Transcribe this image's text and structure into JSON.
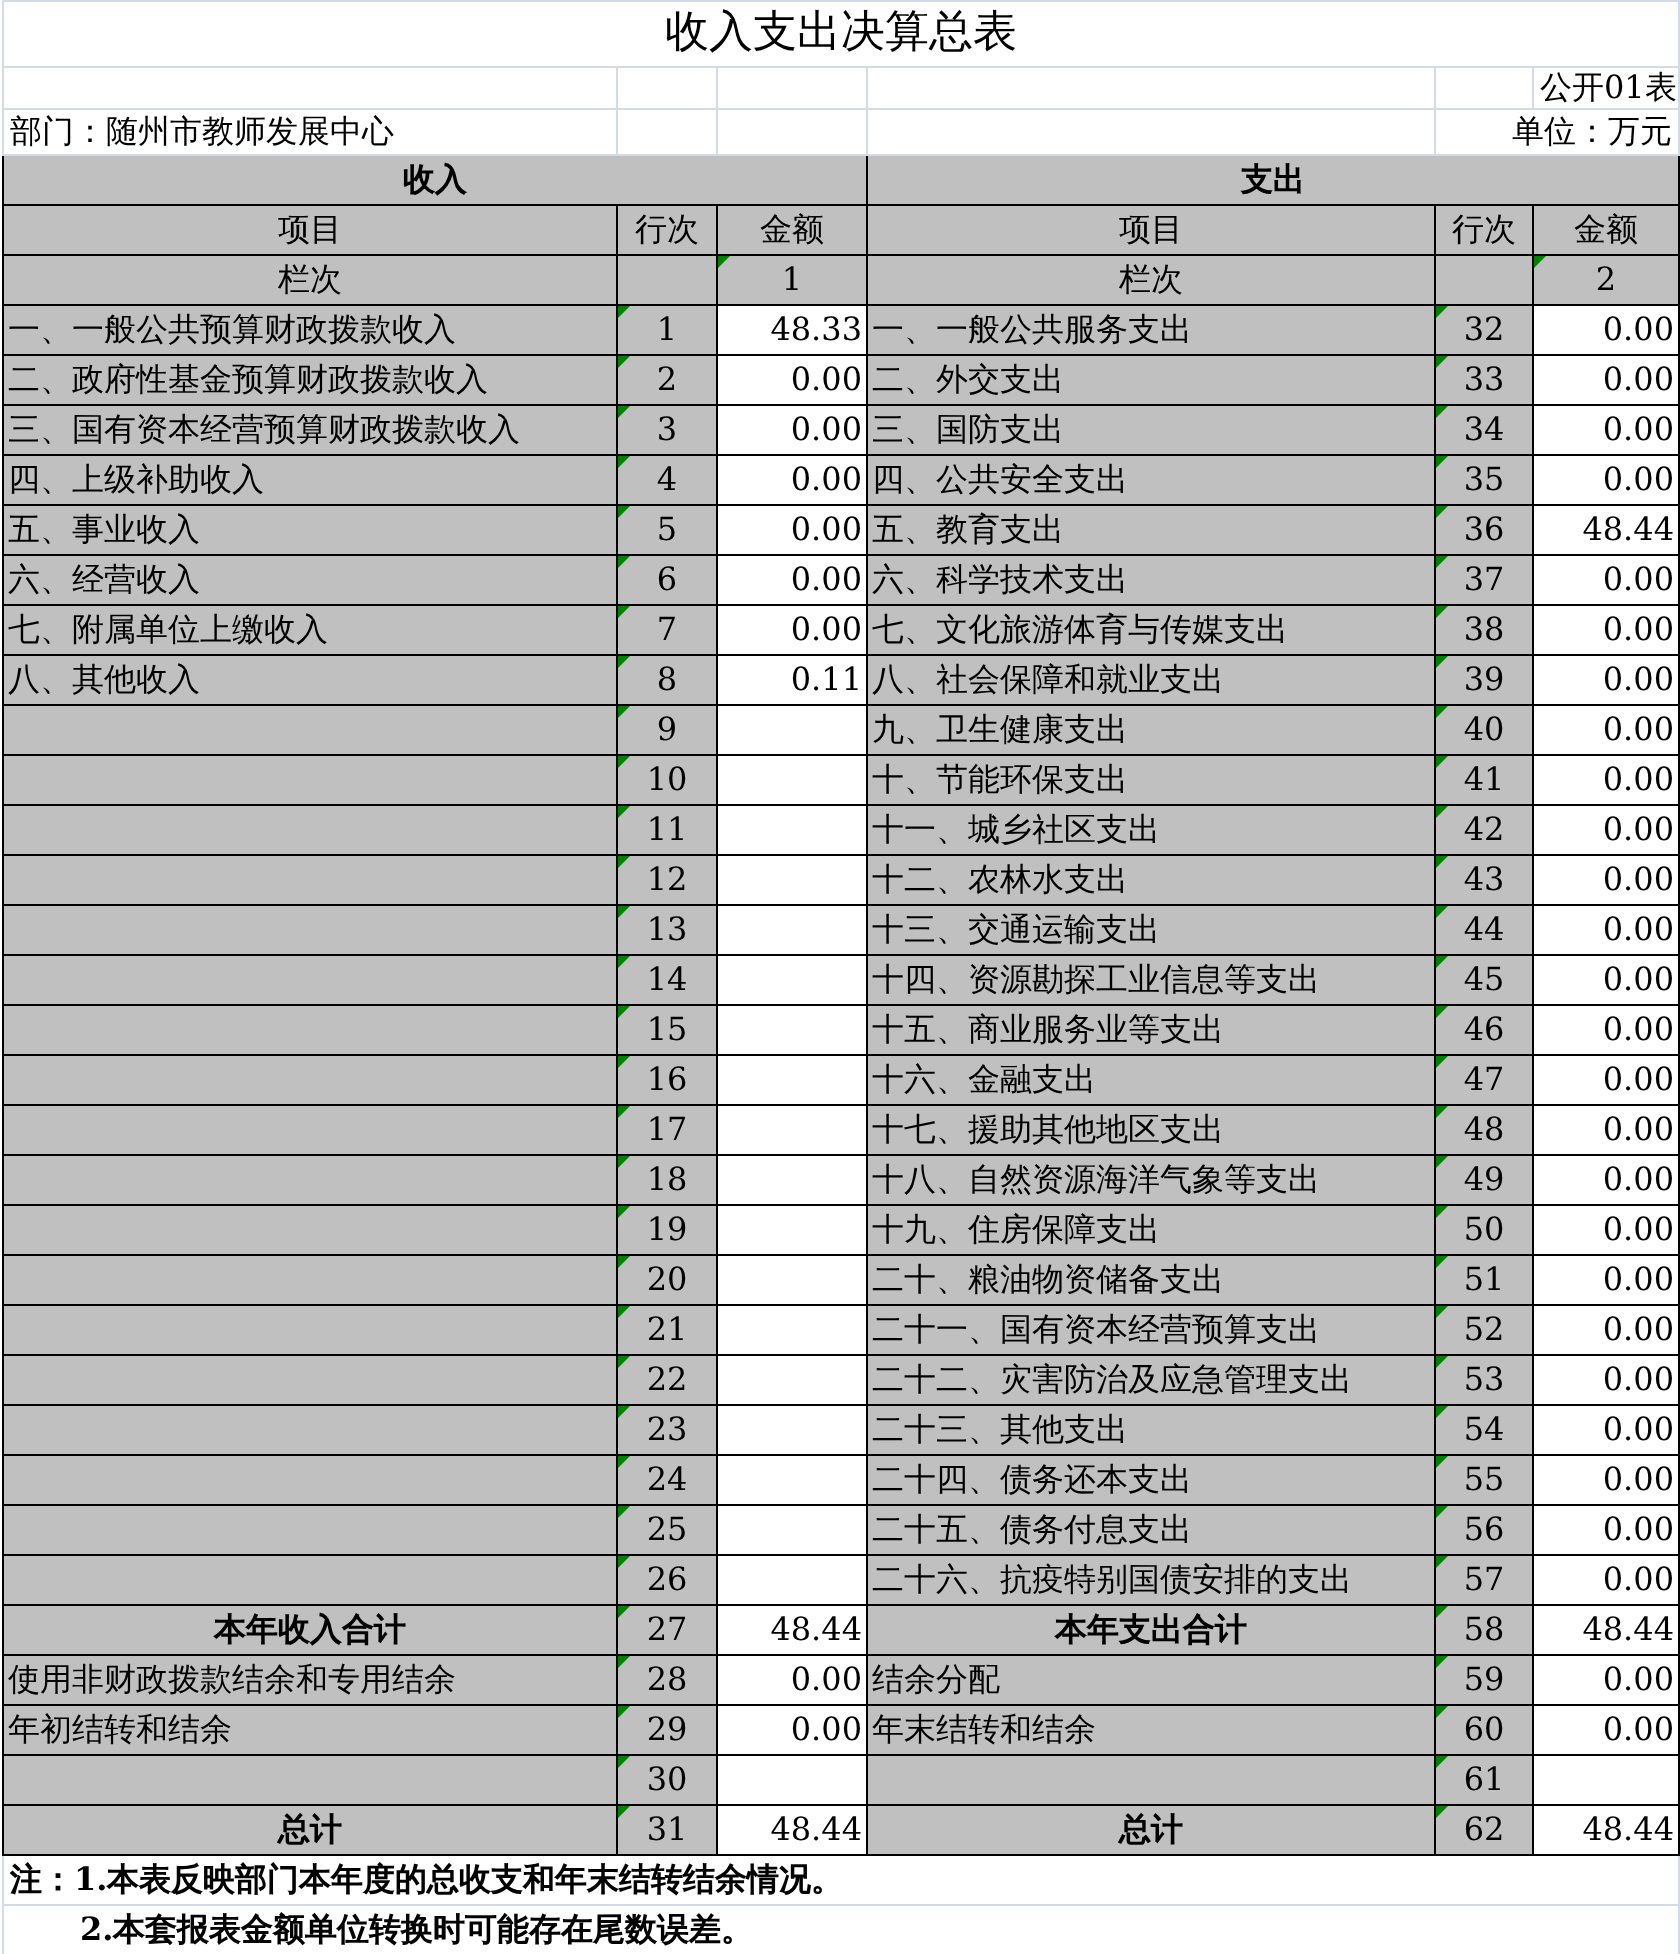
{
  "title": "收入支出决算总表",
  "form_code": "公开01表",
  "department": "部门：随州市教师发展中心",
  "unit": "单位：万元",
  "sections": [
    "收入",
    "支出"
  ],
  "column_headers": {
    "left": [
      "项目",
      "行次",
      "金额"
    ],
    "right": [
      "项目",
      "行次",
      "金额"
    ]
  },
  "column_index": {
    "left": {
      "label": "栏次",
      "number": "1"
    },
    "right": {
      "label": "栏次",
      "number": "2"
    }
  },
  "rows": [
    {
      "left": {
        "kind": "item",
        "item": "一、一般公共预算财政拨款收入",
        "line": "1",
        "amount": "48.33"
      },
      "right": {
        "kind": "item",
        "item": "一、一般公共服务支出",
        "line": "32",
        "amount": "0.00"
      }
    },
    {
      "left": {
        "kind": "item",
        "item": "二、政府性基金预算财政拨款收入",
        "line": "2",
        "amount": "0.00"
      },
      "right": {
        "kind": "item",
        "item": "二、外交支出",
        "line": "33",
        "amount": "0.00"
      }
    },
    {
      "left": {
        "kind": "item",
        "item": "三、国有资本经营预算财政拨款收入",
        "line": "3",
        "amount": "0.00"
      },
      "right": {
        "kind": "item",
        "item": "三、国防支出",
        "line": "34",
        "amount": "0.00"
      }
    },
    {
      "left": {
        "kind": "item",
        "item": "四、上级补助收入",
        "line": "4",
        "amount": "0.00"
      },
      "right": {
        "kind": "item",
        "item": "四、公共安全支出",
        "line": "35",
        "amount": "0.00"
      }
    },
    {
      "left": {
        "kind": "item",
        "item": "五、事业收入",
        "line": "5",
        "amount": "0.00"
      },
      "right": {
        "kind": "item",
        "item": "五、教育支出",
        "line": "36",
        "amount": "48.44"
      }
    },
    {
      "left": {
        "kind": "item",
        "item": "六、经营收入",
        "line": "6",
        "amount": "0.00"
      },
      "right": {
        "kind": "item",
        "item": "六、科学技术支出",
        "line": "37",
        "amount": "0.00"
      }
    },
    {
      "left": {
        "kind": "item",
        "item": "七、附属单位上缴收入",
        "line": "7",
        "amount": "0.00"
      },
      "right": {
        "kind": "item",
        "item": "七、文化旅游体育与传媒支出",
        "line": "38",
        "amount": "0.00"
      }
    },
    {
      "left": {
        "kind": "item",
        "item": "八、其他收入",
        "line": "8",
        "amount": "0.11"
      },
      "right": {
        "kind": "item",
        "item": "八、社会保障和就业支出",
        "line": "39",
        "amount": "0.00"
      }
    },
    {
      "left": {
        "kind": "item",
        "line": "9"
      },
      "right": {
        "kind": "item",
        "item": "九、卫生健康支出",
        "line": "40",
        "amount": "0.00"
      }
    },
    {
      "left": {
        "kind": "item",
        "line": "10"
      },
      "right": {
        "kind": "item",
        "item": "十、节能环保支出",
        "line": "41",
        "amount": "0.00"
      }
    },
    {
      "left": {
        "kind": "item",
        "line": "11"
      },
      "right": {
        "kind": "item",
        "item": "十一、城乡社区支出",
        "line": "42",
        "amount": "0.00"
      }
    },
    {
      "left": {
        "kind": "item",
        "line": "12"
      },
      "right": {
        "kind": "item",
        "item": "十二、农林水支出",
        "line": "43",
        "amount": "0.00"
      }
    },
    {
      "left": {
        "kind": "item",
        "line": "13"
      },
      "right": {
        "kind": "item",
        "item": "十三、交通运输支出",
        "line": "44",
        "amount": "0.00"
      }
    },
    {
      "left": {
        "kind": "item",
        "line": "14"
      },
      "right": {
        "kind": "item",
        "item": "十四、资源勘探工业信息等支出",
        "line": "45",
        "amount": "0.00"
      }
    },
    {
      "left": {
        "kind": "item",
        "line": "15"
      },
      "right": {
        "kind": "item",
        "item": "十五、商业服务业等支出",
        "line": "46",
        "amount": "0.00"
      }
    },
    {
      "left": {
        "kind": "item",
        "line": "16"
      },
      "right": {
        "kind": "item",
        "item": "十六、金融支出",
        "line": "47",
        "amount": "0.00"
      }
    },
    {
      "left": {
        "kind": "item",
        "line": "17"
      },
      "right": {
        "kind": "item",
        "item": "十七、援助其他地区支出",
        "line": "48",
        "amount": "0.00"
      }
    },
    {
      "left": {
        "kind": "item",
        "line": "18"
      },
      "right": {
        "kind": "item",
        "item": "十八、自然资源海洋气象等支出",
        "line": "49",
        "amount": "0.00"
      }
    },
    {
      "left": {
        "kind": "item",
        "line": "19"
      },
      "right": {
        "kind": "item",
        "item": "十九、住房保障支出",
        "line": "50",
        "amount": "0.00"
      }
    },
    {
      "left": {
        "kind": "item",
        "line": "20"
      },
      "right": {
        "kind": "item",
        "item": "二十、粮油物资储备支出",
        "line": "51",
        "amount": "0.00"
      }
    },
    {
      "left": {
        "kind": "item",
        "line": "21"
      },
      "right": {
        "kind": "item",
        "item": "二十一、国有资本经营预算支出",
        "line": "52",
        "amount": "0.00"
      }
    },
    {
      "left": {
        "kind": "item",
        "line": "22"
      },
      "right": {
        "kind": "item",
        "item": "二十二、灾害防治及应急管理支出",
        "line": "53",
        "amount": "0.00"
      }
    },
    {
      "left": {
        "kind": "item",
        "line": "23"
      },
      "right": {
        "kind": "item",
        "item": "二十三、其他支出",
        "line": "54",
        "amount": "0.00"
      }
    },
    {
      "left": {
        "kind": "item",
        "line": "24"
      },
      "right": {
        "kind": "item",
        "item": "二十四、债务还本支出",
        "line": "55",
        "amount": "0.00"
      }
    },
    {
      "left": {
        "kind": "item",
        "line": "25"
      },
      "right": {
        "kind": "item",
        "item": "二十五、债务付息支出",
        "line": "56",
        "amount": "0.00"
      }
    },
    {
      "left": {
        "kind": "item",
        "line": "26"
      },
      "right": {
        "kind": "item",
        "item": "二十六、抗疫特别国债安排的支出",
        "line": "57",
        "amount": "0.00"
      }
    },
    {
      "left": {
        "kind": "total",
        "item": "本年收入合计",
        "line": "27",
        "amount": "48.44"
      },
      "right": {
        "kind": "total",
        "item": "本年支出合计",
        "line": "58",
        "amount": "48.44"
      }
    },
    {
      "left": {
        "kind": "item",
        "item": "使用非财政拨款结余和专用结余",
        "line": "28",
        "amount": "0.00"
      },
      "right": {
        "kind": "item",
        "item": "结余分配",
        "line": "59",
        "amount": "0.00"
      }
    },
    {
      "left": {
        "kind": "item",
        "item": "年初结转和结余",
        "line": "29",
        "amount": "0.00"
      },
      "right": {
        "kind": "item",
        "item": "年末结转和结余",
        "line": "60",
        "amount": "0.00"
      }
    },
    {
      "left": {
        "kind": "item",
        "line": "30"
      },
      "right": {
        "kind": "item",
        "line": "61"
      }
    },
    {
      "left": {
        "kind": "total",
        "item": "总计",
        "line": "31",
        "amount": "48.44"
      },
      "right": {
        "kind": "total",
        "item": "总计",
        "line": "62",
        "amount": "48.44"
      }
    }
  ],
  "notes": [
    "注：1.本表反映部门本年度的总收支和年末结转结余情况。",
    "2.本套报表金额单位转换时可能存在尾数误差。"
  ]
}
